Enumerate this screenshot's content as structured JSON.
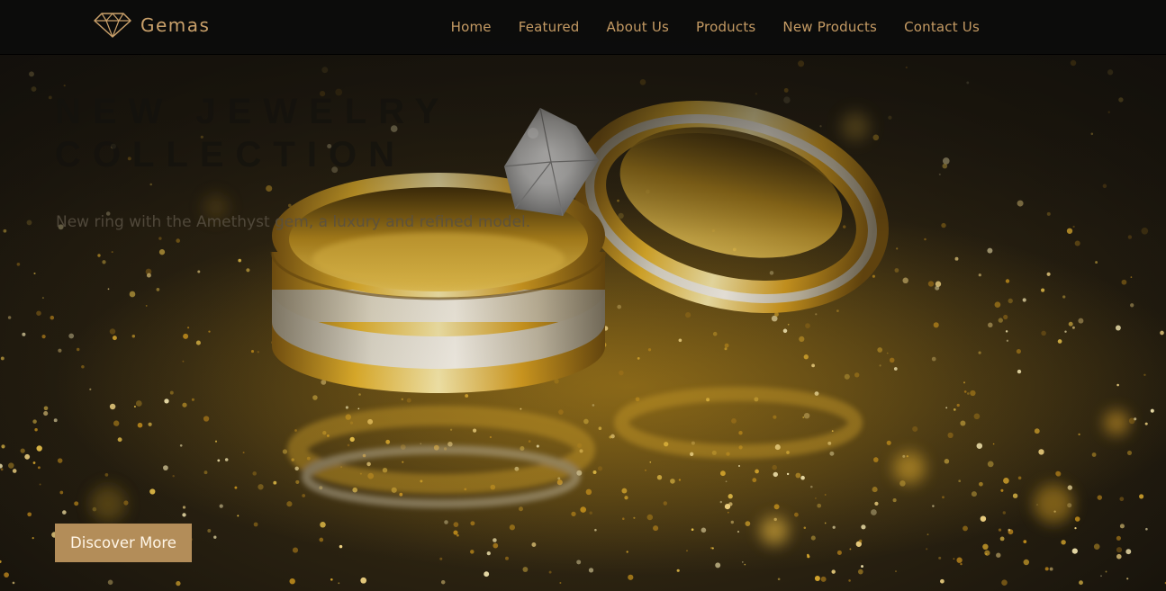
{
  "brand": {
    "name": "Gemas",
    "icon": "diamond-icon",
    "accent_color": "#c9a06a"
  },
  "nav": {
    "items": [
      {
        "label": "Home"
      },
      {
        "label": "Featured"
      },
      {
        "label": "About Us"
      },
      {
        "label": "Products"
      },
      {
        "label": "New Products"
      },
      {
        "label": "Contact Us"
      }
    ],
    "link_color": "#c49a63"
  },
  "hero": {
    "title_line1": "New Jewelry",
    "title_line2": "Collection",
    "subtitle": "New ring with the Amethyst gem, a luxury and refined model.",
    "cta_label": "Discover More",
    "cta_color": "#b38d59",
    "background": "gold-rings-glitter-photo"
  }
}
